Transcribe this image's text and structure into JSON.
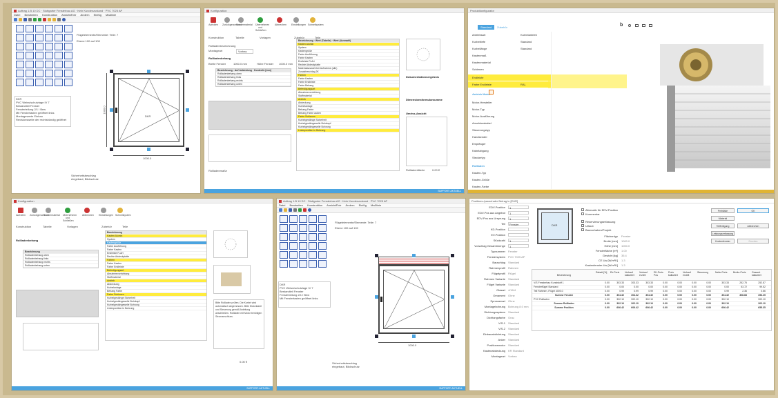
{
  "colors": {
    "accent": "#4aa3df",
    "highlight": "#ffec3d",
    "gold": "#e0b434",
    "status_red": "#cc3333",
    "status_green": "#2e9e3e"
  },
  "panes": {
    "cad_top": {
      "title": "Auftrag 1.B 10 DC · Stuttgarter Fensterbau AG · Kein Kundenzustand · PVC 7025 AP",
      "menu": [
        "Datei",
        "Bearbeiten",
        "Konstruktion",
        "Ansicht/Extr",
        "Ändern",
        "Einfüg",
        "Maßlinie"
      ],
      "position_label": "Flügelelemente/Elemente: Teile: 7",
      "center_label": "Ebene 100 auf 100",
      "sash_label": "DKR",
      "width_dim": "1000.0",
      "height_dim": "1000.0",
      "info_lines": [
        "DKR",
        "PVC Weiss/schutzlage IV 7",
        "Bestandteil Fenster",
        "Fensterteilung 2/1 I Bew",
        "Mit Fenstertasten geöffnet links",
        "Montagewerte Einbau",
        "Revisionsweite der rechtsbündig geöffnet"
      ],
      "bottom_note": "Sicherheitsbeschlag eingebaut, Blickschutz"
    },
    "config_top": {
      "title": "Konfiguration",
      "tools": [
        "Aufrollen",
        "Zurückgenommen",
        "Sondermaterial",
        "Übernehmen und Schließen",
        "Abbrechen",
        "Einstellungen",
        "Schnellsystem"
      ],
      "subtabs": [
        "Konstruktion",
        "Tabelle",
        "Vorlagen",
        "Zubehör",
        "Teile"
      ],
      "fields": [
        {
          "label": "Rollladenbezeichnung",
          "value": ""
        },
        {
          "label": "Montageart",
          "value": "Vorbau"
        }
      ],
      "section_behang": "Rollladenbehang",
      "breite_label": "Breite Fenster",
      "breite_value": "1000.0 mm",
      "hoehe_label": "Höhe Fenster",
      "hoehe_value": "1000.0 mm",
      "behang_rows": [
        "Rollladenbehang oben",
        "Rollladenbehang links",
        "Rollladenbehang rechts",
        "Rollladenbehang unten"
      ],
      "col_heads": [
        "Bezeichnung",
        "Auf Anbindung",
        "Kontrolle [mm]"
      ],
      "attr_heads": [
        "Bezeichnung",
        "Wert (Tabelle)",
        "Wert (Auswahl)"
      ],
      "attr_rows": [
        "Kasten Alumin",
        "System",
        "Kastengröße",
        "Farbe Ausführung",
        "Farbe Kasten",
        "Endleiste R-Art",
        "Rechte Abdeckplatte",
        "Materialauswahl bei Aufnahme (alle)",
        "Zusatzbeschlag 2K",
        "Farben",
        "Farbe Kasten",
        "Farbe Endleiste",
        "Farbe Behang",
        "Befestigungsart",
        "Abnahmevorrichtung",
        "Stoffmaterial",
        "Antrieb",
        "Abdeckung",
        "Kurbelanlage",
        "Behang Farbe",
        "Behang Farbe außen",
        "Farbe Schienen",
        "Kurbelgestänge Sicherheit",
        "Kurbelgestängewelle Bohrkopf",
        "Kurbelgestängewelle Bohrung",
        "Linienposition in Bohrung"
      ],
      "right_sections": [
        "Dokumentationsergebnis",
        "Dimensionsformularsumme",
        "Umriss-Ansicht"
      ],
      "bottom_label": "Rollladenmaße",
      "total_label": "Rollladenfläche",
      "total_value": "0.00 €"
    },
    "product_top": {
      "title": "Produktkonfigurator",
      "tabs": [
        "Standard",
        "Zubehör"
      ],
      "rows": [
        {
          "label": "Antriebsart",
          "value": "Kurbelantrieb"
        },
        {
          "label": "Kurbeltiefe",
          "value": "Standard"
        },
        {
          "label": "Kurbellänge",
          "value": "Standard"
        },
        {
          "label": "Kastenmaß",
          "value": ""
        },
        {
          "label": "Kastenmaterial",
          "value": ""
        },
        {
          "label": "Schienen",
          "value": ""
        },
        {
          "label": "Endleiste",
          "value": ""
        },
        {
          "label": "Farbe Endleiste",
          "value": "RAL"
        },
        {
          "label": "Farbe Kasten",
          "value": "RAL"
        },
        {
          "label": "Farbe Behang",
          "value": "Brilliant Weiss"
        }
      ],
      "section_antrieb": "Antrieb Motor",
      "motor_rows": [
        "Motor-Hersteller",
        "Motor-Typ",
        "Motor-Ausführung",
        "Anschlusskabel",
        "Steuerungstyp",
        "Handsender",
        "Empfänger",
        "Kabelabgang",
        "Steckertyp"
      ],
      "section_kasten": "Rollladen",
      "kasten_rows": [
        "Kasten-Typ",
        "Kasten-Größe",
        "Kasten-Farbe"
      ]
    },
    "config_bottom": {
      "title": "Konfiguration",
      "tools": [
        "Aufrollen",
        "Zurückgenommen",
        "Sondermaterial",
        "Übernehmen und Schließen",
        "Abbrechen",
        "Einstellungen",
        "Schnellsystem"
      ],
      "subtabs": [
        "Konstruktion",
        "Tabelle",
        "Vorlagen",
        "Zubehör",
        "Teile"
      ],
      "info_text": "Bitte Rollladen prüfen. Die Kurbel wird automatisch abgemessen. Bitte Motorkabel und Steuerung gemäß Anleitung anschließen. Rollläden mit Motor benötigen Stromanschluss.",
      "total_value": "0.00 €"
    },
    "cad_bottom": {
      "title": "Auftrag 1.B 10 DC · Stuttgarter Fensterbau AG · Kein Kundenzustand · PVC 7025 AP",
      "menu": [
        "Datei",
        "Bearbeiten",
        "Konstruktion",
        "Ansicht/Extr",
        "Ändern",
        "Einfüg",
        "Maßlinie"
      ],
      "width_dim": "1000.0",
      "status": "SUPPORT: AKTUELL"
    },
    "pricing": {
      "title": "Positions-/pauschaler Betrag in [EUR]",
      "left_fields": [
        {
          "label": "EDV-Position",
          "value": "1"
        },
        {
          "label": "EDV-Pos aus Angebot",
          "value": "1"
        },
        {
          "label": "EDV-Pos aus Ursprung",
          "value": "1"
        },
        {
          "label": "Teil",
          "value": "Fenster"
        },
        {
          "label": "KD-Position",
          "value": ""
        },
        {
          "label": "EV-Position",
          "value": ""
        },
        {
          "label": "Stückzahl",
          "value": "1"
        },
        {
          "label": "Vorschlag Gesamtmenge",
          "value": "1"
        },
        {
          "label": "Typnummer",
          "value": "Fenster"
        },
        {
          "label": "Fenstersystem",
          "value": "PVC 7025 AP"
        },
        {
          "label": "Bauschlag",
          "value": "Standard"
        },
        {
          "label": "Rahmenprofil",
          "value": "Rahmen"
        },
        {
          "label": "Flügelprofil",
          "value": "Flügel"
        },
        {
          "label": "Rahmen Variante",
          "value": "Standard"
        },
        {
          "label": "Flügel Variante",
          "value": "Standard"
        },
        {
          "label": "Glasart",
          "value": "4/16/4"
        },
        {
          "label": "Ornament",
          "value": "Ohne"
        },
        {
          "label": "Sprossenart",
          "value": "Ohne"
        },
        {
          "label": "Montagebohrung",
          "value": "Bohrung 8.0 mm"
        },
        {
          "label": "Dichtungssystem",
          "value": "Standard"
        },
        {
          "label": "Dichtungsfarbe",
          "value": "Grau"
        },
        {
          "label": "V/S-1",
          "value": "Standard"
        },
        {
          "label": "V/S-2",
          "value": "Standard"
        },
        {
          "label": "Einbauabdichtung",
          "value": "Standard"
        },
        {
          "label": "Anker",
          "value": "Standard"
        },
        {
          "label": "Positionsmotor",
          "value": "Standard"
        },
        {
          "label": "Kastenabdeckung",
          "value": "KR Standard"
        },
        {
          "label": "Montageart",
          "value": "Vorbau"
        }
      ],
      "sash_label": "DKR",
      "checkboxes": [
        "Alternativ für EDV-Position",
        "Kommentar",
        "Reservierungserfassung",
        "Urlaub",
        "Bauvorhaben/Projekt"
      ],
      "dims": [
        {
          "label": "Flächentyp",
          "value": "Fenster"
        },
        {
          "label": "Breite [mm]",
          "value": "1000.0"
        },
        {
          "label": "Höhe [mm]",
          "value": "1000.0"
        },
        {
          "label": "Fensterfläche [m²]",
          "value": "1.00"
        },
        {
          "label": "Gewicht [kg]",
          "value": "35.4"
        },
        {
          "label": "CE Uw [W/m²K]",
          "value": "1.3"
        },
        {
          "label": "Kastenfenster-Uw [W/m²K]",
          "value": "1.3"
        }
      ],
      "buttons": [
        "Preisliste",
        "OK",
        "Material",
        "Abbrechen",
        "Teilfertigung",
        "Leistungserfassung",
        "Kostenfenster",
        "Drucken"
      ],
      "table_heads": [
        "Bezeichnung",
        "Rabatt [%]",
        "Ek-Preis",
        "Verkauf kalkuliert",
        "Verkauf erzielt",
        "EK-Preis Pos",
        "Preis kalkuliert",
        "Verkauf erzielt",
        "Steuerung",
        "Netto-Preis",
        "Brutto-Preis",
        "Gesamt kalkuliert"
      ],
      "table_rows": [
        {
          "name": "V/S Fensterbau Kunststoff 1",
          "vals": [
            "0.00",
            "303.33",
            "303.33",
            "303.33",
            "0.00",
            "0.00",
            "0.00",
            "0.00",
            "303.33",
            "252.75",
            "252.87"
          ]
        },
        {
          "name": "Fensterflügel Standard",
          "vals": [
            "0.00",
            "0.00",
            "0.00",
            "0.00",
            "0.00",
            "0.00",
            "0.00",
            "0.00",
            "0.00",
            "53.72",
            "99.52"
          ]
        },
        {
          "name": "Teil Rahmen, Flügel 4000.0",
          "vals": [
            "0.00",
            "0.99",
            "0.99",
            "0.99",
            "0.00",
            "0.00",
            "0.00",
            "0.00",
            "0.99",
            "2.36",
            "0.86"
          ]
        },
        {
          "name": "Summe Fenster",
          "vals": [
            "0.00",
            "304.32",
            "304.32",
            "304.32",
            "0.00",
            "0.00",
            "0.00",
            "0.00",
            "304.32",
            "308.83",
            "353.25"
          ]
        },
        {
          "name": "PVC Rollladen",
          "vals": [
            "0.00",
            "302.10",
            "302.10",
            "302.10",
            "0.00",
            "0.00",
            "0.00",
            "0.00",
            "302.10",
            "",
            "302.10"
          ]
        },
        {
          "name": "Summe Rollladen",
          "vals": [
            "0.00",
            "302.10",
            "302.10",
            "302.10",
            "0.00",
            "0.00",
            "0.00",
            "0.00",
            "302.10",
            "",
            "302.10"
          ]
        },
        {
          "name": "Summe Position",
          "vals": [
            "0.00",
            "606.42",
            "606.42",
            "606.42",
            "0.00",
            "0.00",
            "0.00",
            "0.00",
            "606.42",
            "",
            "655.35"
          ]
        }
      ]
    }
  }
}
